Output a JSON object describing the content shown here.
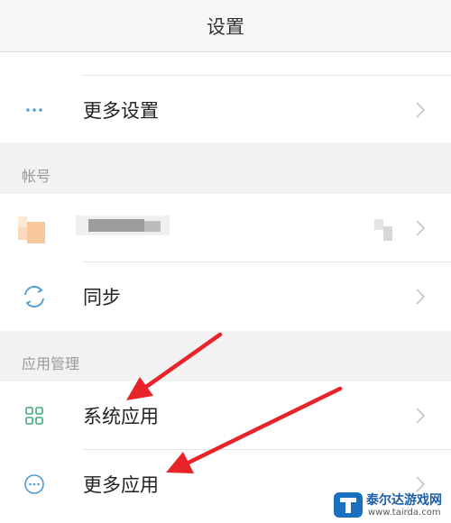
{
  "header": {
    "title": "设置"
  },
  "rows": {
    "more_settings": "更多设置",
    "sync": "同步",
    "system_apps": "系统应用",
    "more_apps": "更多应用"
  },
  "sections": {
    "account": "帐号",
    "app_management": "应用管理"
  },
  "watermark": {
    "text": "泰尔达游戏网",
    "url": "www.tairda.com"
  },
  "colors": {
    "accent_icon": "#4a9bd6",
    "green_icon": "#3daa7a",
    "annotation_arrow": "#e8232a",
    "chevron": "#c4c4c4"
  }
}
